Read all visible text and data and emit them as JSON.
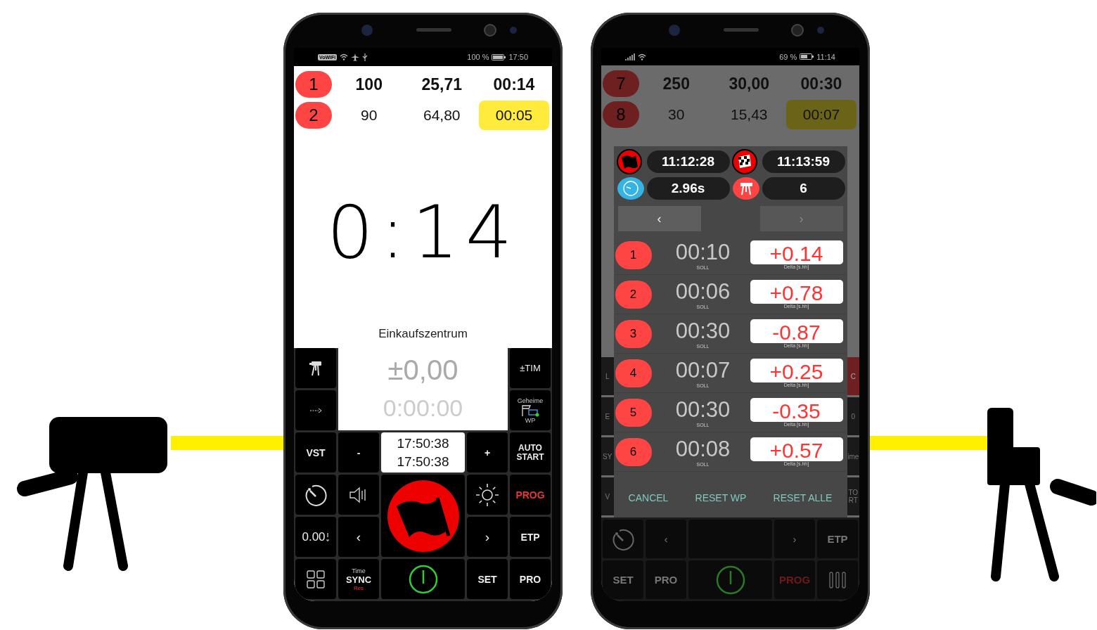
{
  "left_phone": {
    "status_bar": {
      "network_label": "VoWiFi",
      "battery": "100 %",
      "time": "17:50"
    },
    "rows": [
      {
        "number": "1",
        "distance": "100",
        "speed": "25,71",
        "time": "00:14",
        "active": true,
        "highlighted": false
      },
      {
        "number": "2",
        "distance": "90",
        "speed": "64,80",
        "time": "00:05",
        "active": false,
        "highlighted": true
      }
    ],
    "clock": "0:14",
    "location": "Einkaufszentrum",
    "display": {
      "offset": "±0,00",
      "elapsed": "0:00:00"
    },
    "keys": {
      "tim": "±TIM",
      "secret_top": "Geheime",
      "secret_bottom": "WP",
      "vst": "VST",
      "minus": "-",
      "times": [
        "17:50:38",
        "17:50:38"
      ],
      "plus": "+",
      "auto_start": "AUTO START",
      "prog": "PROG",
      "decimals": "0.00",
      "prev": "‹",
      "next": "›",
      "etp": "ETP",
      "sync_top": "Time",
      "sync": "SYNC",
      "sync_bottom": "Res",
      "set": "SET",
      "pro": "PRO"
    }
  },
  "right_phone": {
    "status_bar": {
      "battery": "69 %",
      "time": "11:14"
    },
    "rows": [
      {
        "number": "7",
        "distance": "250",
        "speed": "30,00",
        "time": "00:30",
        "active": true,
        "highlighted": false
      },
      {
        "number": "8",
        "distance": "30",
        "speed": "15,43",
        "time": "00:07",
        "active": false,
        "highlighted": true
      }
    ],
    "left_fragments": [
      "L",
      "E",
      "SY",
      "V"
    ],
    "right_fragments": [
      "C",
      "0",
      "ime",
      "TO RT"
    ],
    "dialog": {
      "start_time": "11:12:28",
      "finish_time": "11:13:59",
      "interval": "2.96s",
      "count": "6",
      "prev": {
        "label": "‹",
        "disabled": false
      },
      "next": {
        "label": "›",
        "disabled": true
      },
      "rows": [
        {
          "number": "1",
          "target": "00:10",
          "target_label": "SOLL",
          "delta": "+0.14",
          "delta_label": "Delta [s.hh]"
        },
        {
          "number": "2",
          "target": "00:06",
          "target_label": "SOLL",
          "delta": "+0.78",
          "delta_label": "Delta [s.hh]"
        },
        {
          "number": "3",
          "target": "00:30",
          "target_label": "SOLL",
          "delta": "-0.87",
          "delta_label": "Delta [s.hh]"
        },
        {
          "number": "4",
          "target": "00:07",
          "target_label": "SOLL",
          "delta": "+0.25",
          "delta_label": "Delta [s.hh]"
        },
        {
          "number": "5",
          "target": "00:30",
          "target_label": "SOLL",
          "delta": "-0.35",
          "delta_label": "Delta [s.hh]"
        },
        {
          "number": "6",
          "target": "00:08",
          "target_label": "SOLL",
          "delta": "+0.57",
          "delta_label": "Delta [s.hh]"
        }
      ],
      "actions": [
        "CANCEL",
        "RESET WP",
        "RESET ALLE"
      ]
    },
    "keys": {
      "prev": "‹",
      "next": "›",
      "etp": "ETP",
      "set": "SET",
      "pro": "PRO",
      "prog": "PROG"
    }
  }
}
